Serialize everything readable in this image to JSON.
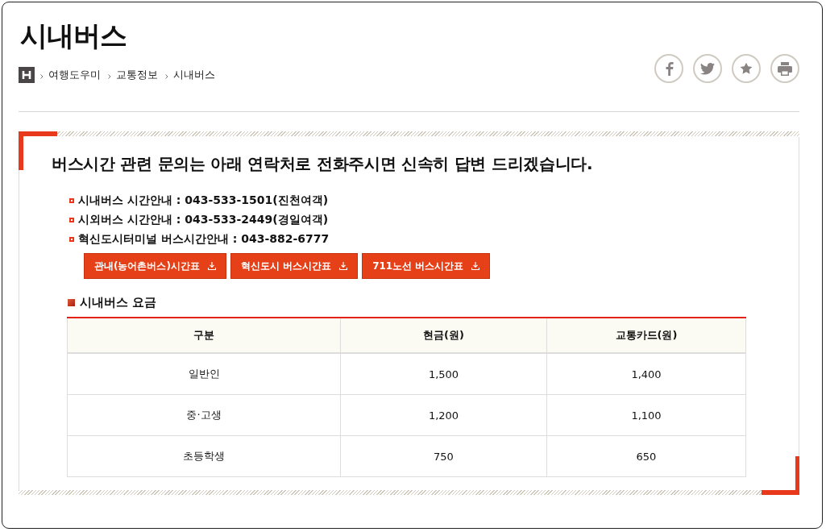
{
  "page_title": "시내버스",
  "breadcrumb": [
    "여행도우미",
    "교통정보",
    "시내버스"
  ],
  "notice": {
    "heading": "버스시간 관련 문의는 아래 연락처로 전화주시면 신속히 답변 드리겠습니다.",
    "contacts": [
      "시내버스 시간안내 : 043-533-1501(진천여객)",
      "시외버스 시간안내 : 043-533-2449(경일여객)",
      "혁신도시터미널 버스시간안내 : 043-882-6777"
    ],
    "buttons": [
      "관내(농어촌버스)시간표",
      "혁신도시 버스시간표",
      "711노선 버스시간표"
    ]
  },
  "fare_section": {
    "title": "시내버스 요금",
    "columns": [
      "구분",
      "현금(원)",
      "교통카드(원)"
    ],
    "rows": [
      [
        "일반인",
        "1,500",
        "1,400"
      ],
      [
        "중·고생",
        "1,200",
        "1,100"
      ],
      [
        "초등학생",
        "750",
        "650"
      ]
    ]
  }
}
